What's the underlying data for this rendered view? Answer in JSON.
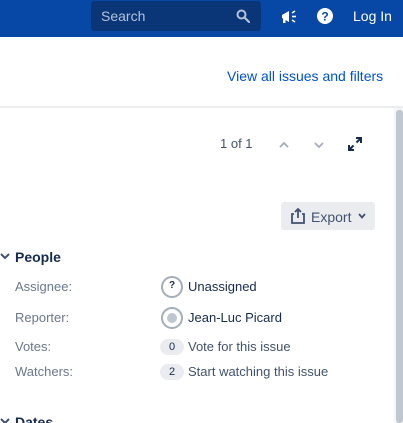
{
  "topbar": {
    "search_placeholder": "Search",
    "login_label": "Log In"
  },
  "filters": {
    "view_all_label": "View all issues and filters"
  },
  "pager": {
    "text": "1 of 1"
  },
  "toolbar": {
    "export_label": "Export"
  },
  "people": {
    "title": "People",
    "assignee_label": "Assignee:",
    "assignee_value": "Unassigned",
    "reporter_label": "Reporter:",
    "reporter_value": "Jean-Luc Picard",
    "votes_label": "Votes:",
    "votes_count": "0",
    "votes_action": "Vote for this issue",
    "watchers_label": "Watchers:",
    "watchers_count": "2",
    "watchers_action": "Start watching this issue"
  },
  "dates": {
    "title": "Dates"
  },
  "colors": {
    "topbar": "#0747a6",
    "link": "#0052cc",
    "text": "#172b4d",
    "muted": "#6b778c"
  },
  "icons": [
    "search-icon",
    "megaphone-icon",
    "help-icon",
    "chevron-up-icon",
    "chevron-down-icon",
    "expand-icon",
    "export-icon",
    "chevron-down-icon",
    "collapse-icon"
  ]
}
